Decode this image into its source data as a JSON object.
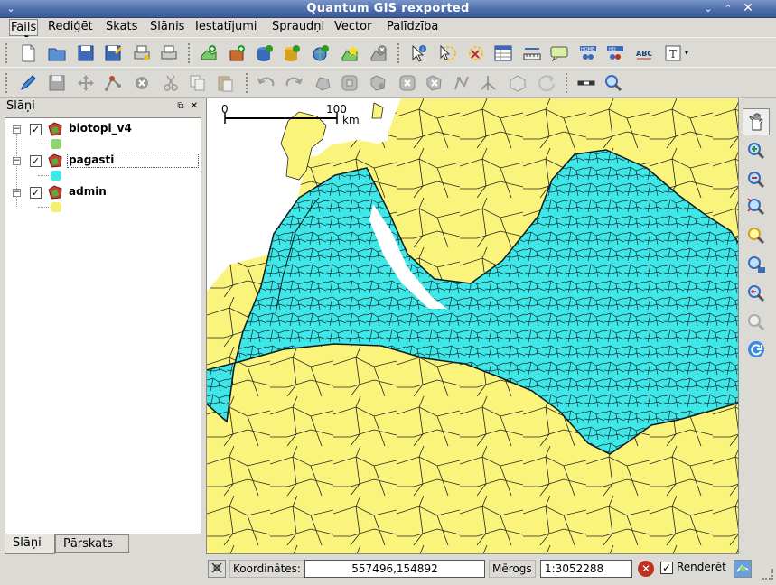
{
  "window": {
    "title": "Quantum GIS rexported"
  },
  "menu": [
    {
      "label": "Fails"
    },
    {
      "label": "Rediģēt"
    },
    {
      "label": "Skats"
    },
    {
      "label": "Slānis"
    },
    {
      "label": "Iestatījumi"
    },
    {
      "label": "Spraudņi"
    },
    {
      "label": "Vector"
    },
    {
      "label": "Palīdzība"
    }
  ],
  "layers_panel": {
    "title": "Slāņi",
    "layers": [
      {
        "name": "biotopi_v4",
        "visible": true,
        "symbol_color": "#8fd46e"
      },
      {
        "name": "pagasti",
        "visible": true,
        "symbol_color": "#3ee8e8"
      },
      {
        "name": "admin",
        "visible": true,
        "symbol_color": "#f5ee74"
      }
    ],
    "tabs": [
      {
        "label": "Slāņi"
      },
      {
        "label": "Pārskats"
      }
    ]
  },
  "map": {
    "scalebar": {
      "start": "0",
      "end": "100",
      "unit": "km"
    },
    "colors": {
      "sea": "#ffffff",
      "land": "#fbf47c",
      "parishes": "#3ee8e8"
    }
  },
  "statusbar": {
    "coord_label": "Koordinātes:",
    "coord_value": "557496,154892",
    "scale_label": "Mērogs",
    "scale_value": "1:3052288",
    "render_label": "Renderēt",
    "render_checked": true
  }
}
